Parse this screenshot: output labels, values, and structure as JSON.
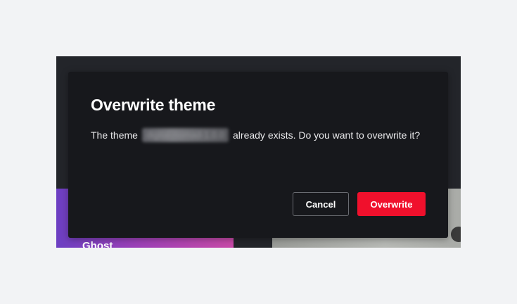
{
  "background": {
    "cards": [
      {
        "label": "Ghost"
      }
    ]
  },
  "dialog": {
    "title": "Overwrite theme",
    "message_before": "The theme ",
    "theme_name": "digital-nomad-1.0.0",
    "message_after": " already exists. Do you want to overwrite it?",
    "cancel_label": "Cancel",
    "overwrite_label": "Overwrite"
  },
  "colors": {
    "dialog_background": "#17181c",
    "danger": "#f0102c",
    "page_background": "#f2f3f5"
  }
}
